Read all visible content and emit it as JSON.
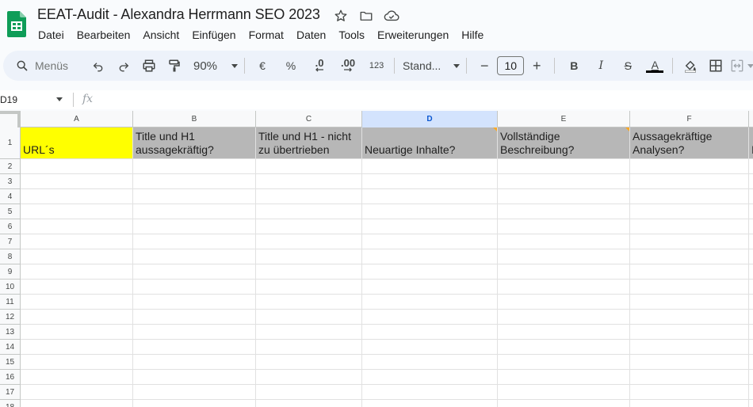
{
  "app": {
    "title": "EEAT-Audit - Alexandra Herrmann SEO 2023",
    "icons": [
      "star-icon",
      "folder-icon",
      "cloud-saved-icon"
    ]
  },
  "menu": [
    "Datei",
    "Bearbeiten",
    "Ansicht",
    "Einfügen",
    "Format",
    "Daten",
    "Tools",
    "Erweiterungen",
    "Hilfe"
  ],
  "toolbar": {
    "search_placeholder": "Menüs",
    "zoom": "90%",
    "currency": "€",
    "percent": "%",
    "decrease_decimals": ".0",
    "increase_decimals": ".00",
    "number_format": "123",
    "font": "Stand...",
    "font_size": "10",
    "minus": "−",
    "plus": "+",
    "bold": "B",
    "italic": "I",
    "strike": "S",
    "text_color_label": "A",
    "text_color": "#000000"
  },
  "formula_bar": {
    "name_box": "D19",
    "fx_label": "fx"
  },
  "sheet": {
    "selected_column": "D",
    "columns": [
      "A",
      "B",
      "C",
      "D",
      "E",
      "F"
    ],
    "rows": [
      "1",
      "2",
      "3",
      "4",
      "5",
      "6",
      "7",
      "8",
      "9",
      "10",
      "11",
      "12",
      "13",
      "14",
      "15",
      "16",
      "17",
      "18"
    ],
    "row1": {
      "A": "URL´s",
      "B": "Title und H1 aussagekräftig?",
      "C": "Title und H1 - nicht zu übertrieben",
      "D": "Neuartige Inhalte?",
      "E": "Vollständige Beschreibung?",
      "F": "Aussagekräftige Analysen?",
      "G": "I"
    },
    "colors": {
      "url_fill": "#ffff00",
      "header_fill": "#b7b7b7",
      "selected_header": "#d3e3fd"
    }
  }
}
